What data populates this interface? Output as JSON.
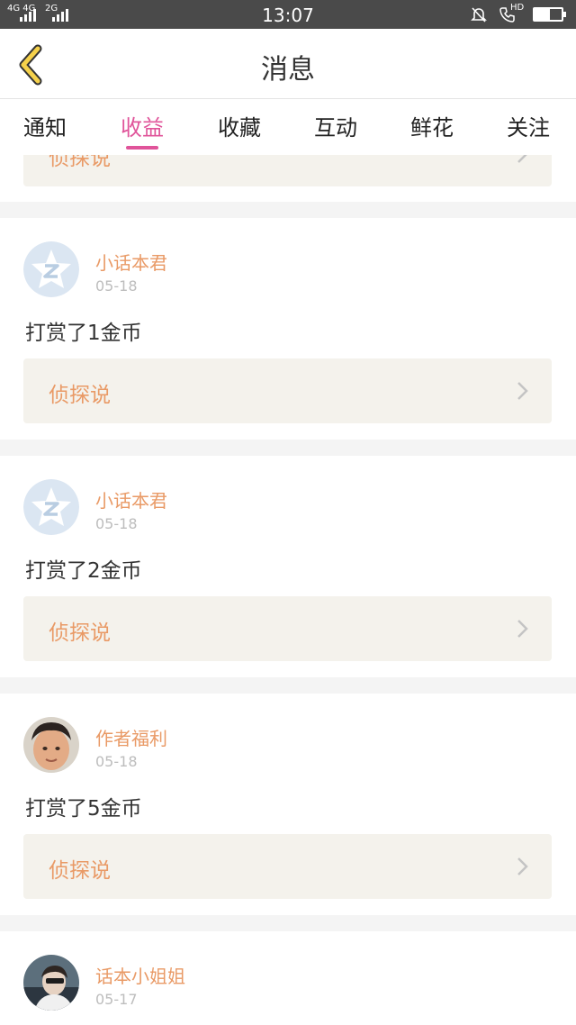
{
  "status_bar": {
    "network_left": "4G 4G",
    "network_right": "2G",
    "time": "13:07",
    "hd_label": "HD"
  },
  "header": {
    "title": "消息"
  },
  "tabs": [
    {
      "label": "通知",
      "active": false
    },
    {
      "label": "收益",
      "active": true
    },
    {
      "label": "收藏",
      "active": false
    },
    {
      "label": "互动",
      "active": false
    },
    {
      "label": "鲜花",
      "active": false
    },
    {
      "label": "关注",
      "active": false
    }
  ],
  "partial_card": {
    "book": "侦探说"
  },
  "messages": [
    {
      "user": "小话本君",
      "date": "05-18",
      "text": "打赏了1金币",
      "book": "侦探说",
      "avatar": "default-avatar"
    },
    {
      "user": "小话本君",
      "date": "05-18",
      "text": "打赏了2金币",
      "book": "侦探说",
      "avatar": "default-avatar"
    },
    {
      "user": "作者福利",
      "date": "05-18",
      "text": "打赏了5金币",
      "book": "侦探说",
      "avatar": "photo-avatar"
    },
    {
      "user": "话本小姐姐",
      "date": "05-17",
      "text": "",
      "book": "",
      "avatar": "photo-avatar"
    }
  ],
  "colors": {
    "accent_pink": "#e0549a",
    "name_orange": "#e99a66",
    "back_yellow": "#f5d14b",
    "book_bg": "#f4f2ec"
  }
}
